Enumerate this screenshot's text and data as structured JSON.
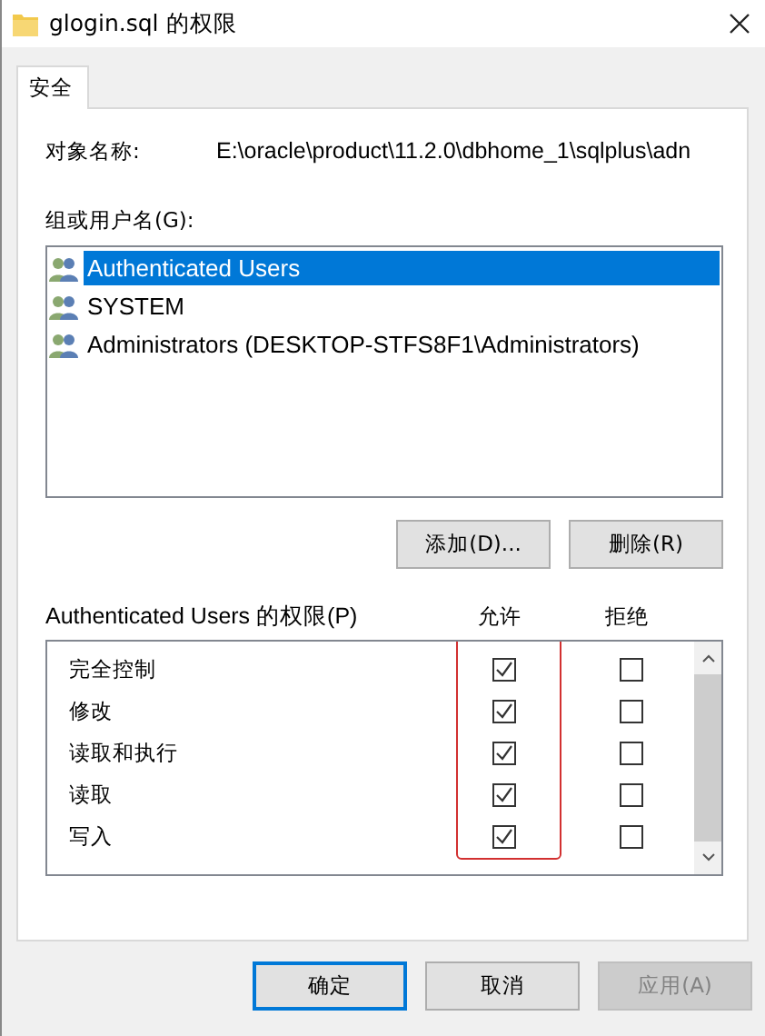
{
  "window": {
    "title": "glogin.sql 的权限"
  },
  "tabs": [
    {
      "label": "安全",
      "selected": true
    }
  ],
  "object_name": {
    "label": "对象名称:",
    "value": "E:\\oracle\\product\\11.2.0\\dbhome_1\\sqlplus\\adn"
  },
  "groups": {
    "label": "组或用户名(G):",
    "items": [
      {
        "name": "Authenticated Users",
        "selected": true
      },
      {
        "name": "SYSTEM",
        "selected": false
      },
      {
        "name": "Administrators (DESKTOP-STFS8F1\\Administrators)",
        "selected": false
      }
    ]
  },
  "group_buttons": [
    "添加(D)...",
    "删除(R)"
  ],
  "permissions": {
    "label": "Authenticated Users 的权限(P)",
    "allow_header": "允许",
    "deny_header": "拒绝",
    "rows": [
      {
        "name": "完全控制",
        "allow": true,
        "deny": false
      },
      {
        "name": "修改",
        "allow": true,
        "deny": false
      },
      {
        "name": "读取和执行",
        "allow": true,
        "deny": false
      },
      {
        "name": "读取",
        "allow": true,
        "deny": false
      },
      {
        "name": "写入",
        "allow": true,
        "deny": false
      }
    ]
  },
  "buttons": [
    {
      "label": "确定",
      "kind": "default",
      "disabled": false
    },
    {
      "label": "取消",
      "kind": "normal",
      "disabled": false
    },
    {
      "label": "应用(A)",
      "kind": "normal",
      "disabled": true
    }
  ]
}
